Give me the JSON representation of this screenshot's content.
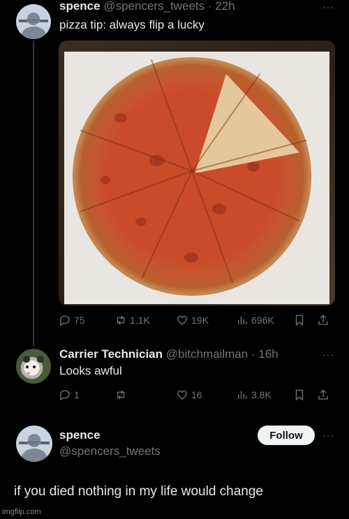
{
  "tweet1": {
    "name": "spence",
    "handle": "@spencers_tweets",
    "time": "· 22h",
    "text": "pizza tip: always flip a lucky",
    "avatar_tag": "spencer's page",
    "image_icon": "pizza-photo",
    "stats": {
      "replies": "75",
      "retweets": "1.1K",
      "likes": "19K",
      "views": "696K"
    }
  },
  "reply": {
    "name": "Carrier Technician",
    "handle": "@bitchmailman",
    "time": "· 16h",
    "text": "Looks awful",
    "avatar_icon": "opossum-avatar",
    "stats": {
      "replies": "1",
      "retweets": "",
      "likes": "16",
      "views": "3.8K"
    }
  },
  "profile": {
    "name": "spence",
    "handle": "@spencers_tweets",
    "avatar_tag": "spencer's page",
    "follow_label": "Follow",
    "text": "if you died nothing in my life would change"
  },
  "watermark": "imgflip.com",
  "more_label": "···",
  "colors": {
    "background": "#000000",
    "text": "#e7e9ea",
    "muted": "#71767b",
    "follow_bg": "#eff3f4"
  }
}
